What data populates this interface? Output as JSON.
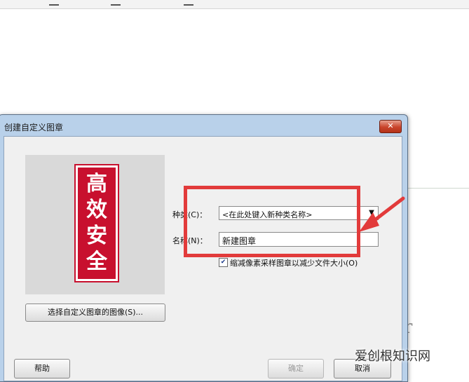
{
  "dialog": {
    "title": "创建自定义图章",
    "close_glyph": "✕",
    "seal_chars": [
      "高",
      "效",
      "安",
      "全"
    ],
    "select_image_button": "选择自定义图章的图像(S)...",
    "category_label": "种类(C)：",
    "category_value": "<在此处键入新种类名称>",
    "name_label": "名称(N)：",
    "name_value": "新建图章",
    "checkbox_checked": true,
    "checkbox_label": "缩减像素采样图章以减少文件大小(O)",
    "help_button": "帮助",
    "ok_button": "确定",
    "cancel_button": "取消"
  },
  "watermark": "爱创根知识网",
  "annotation_color": "#e23b3b",
  "icons": [
    "close-icon",
    "dropdown-arrow-icon",
    "checkmark-icon"
  ]
}
